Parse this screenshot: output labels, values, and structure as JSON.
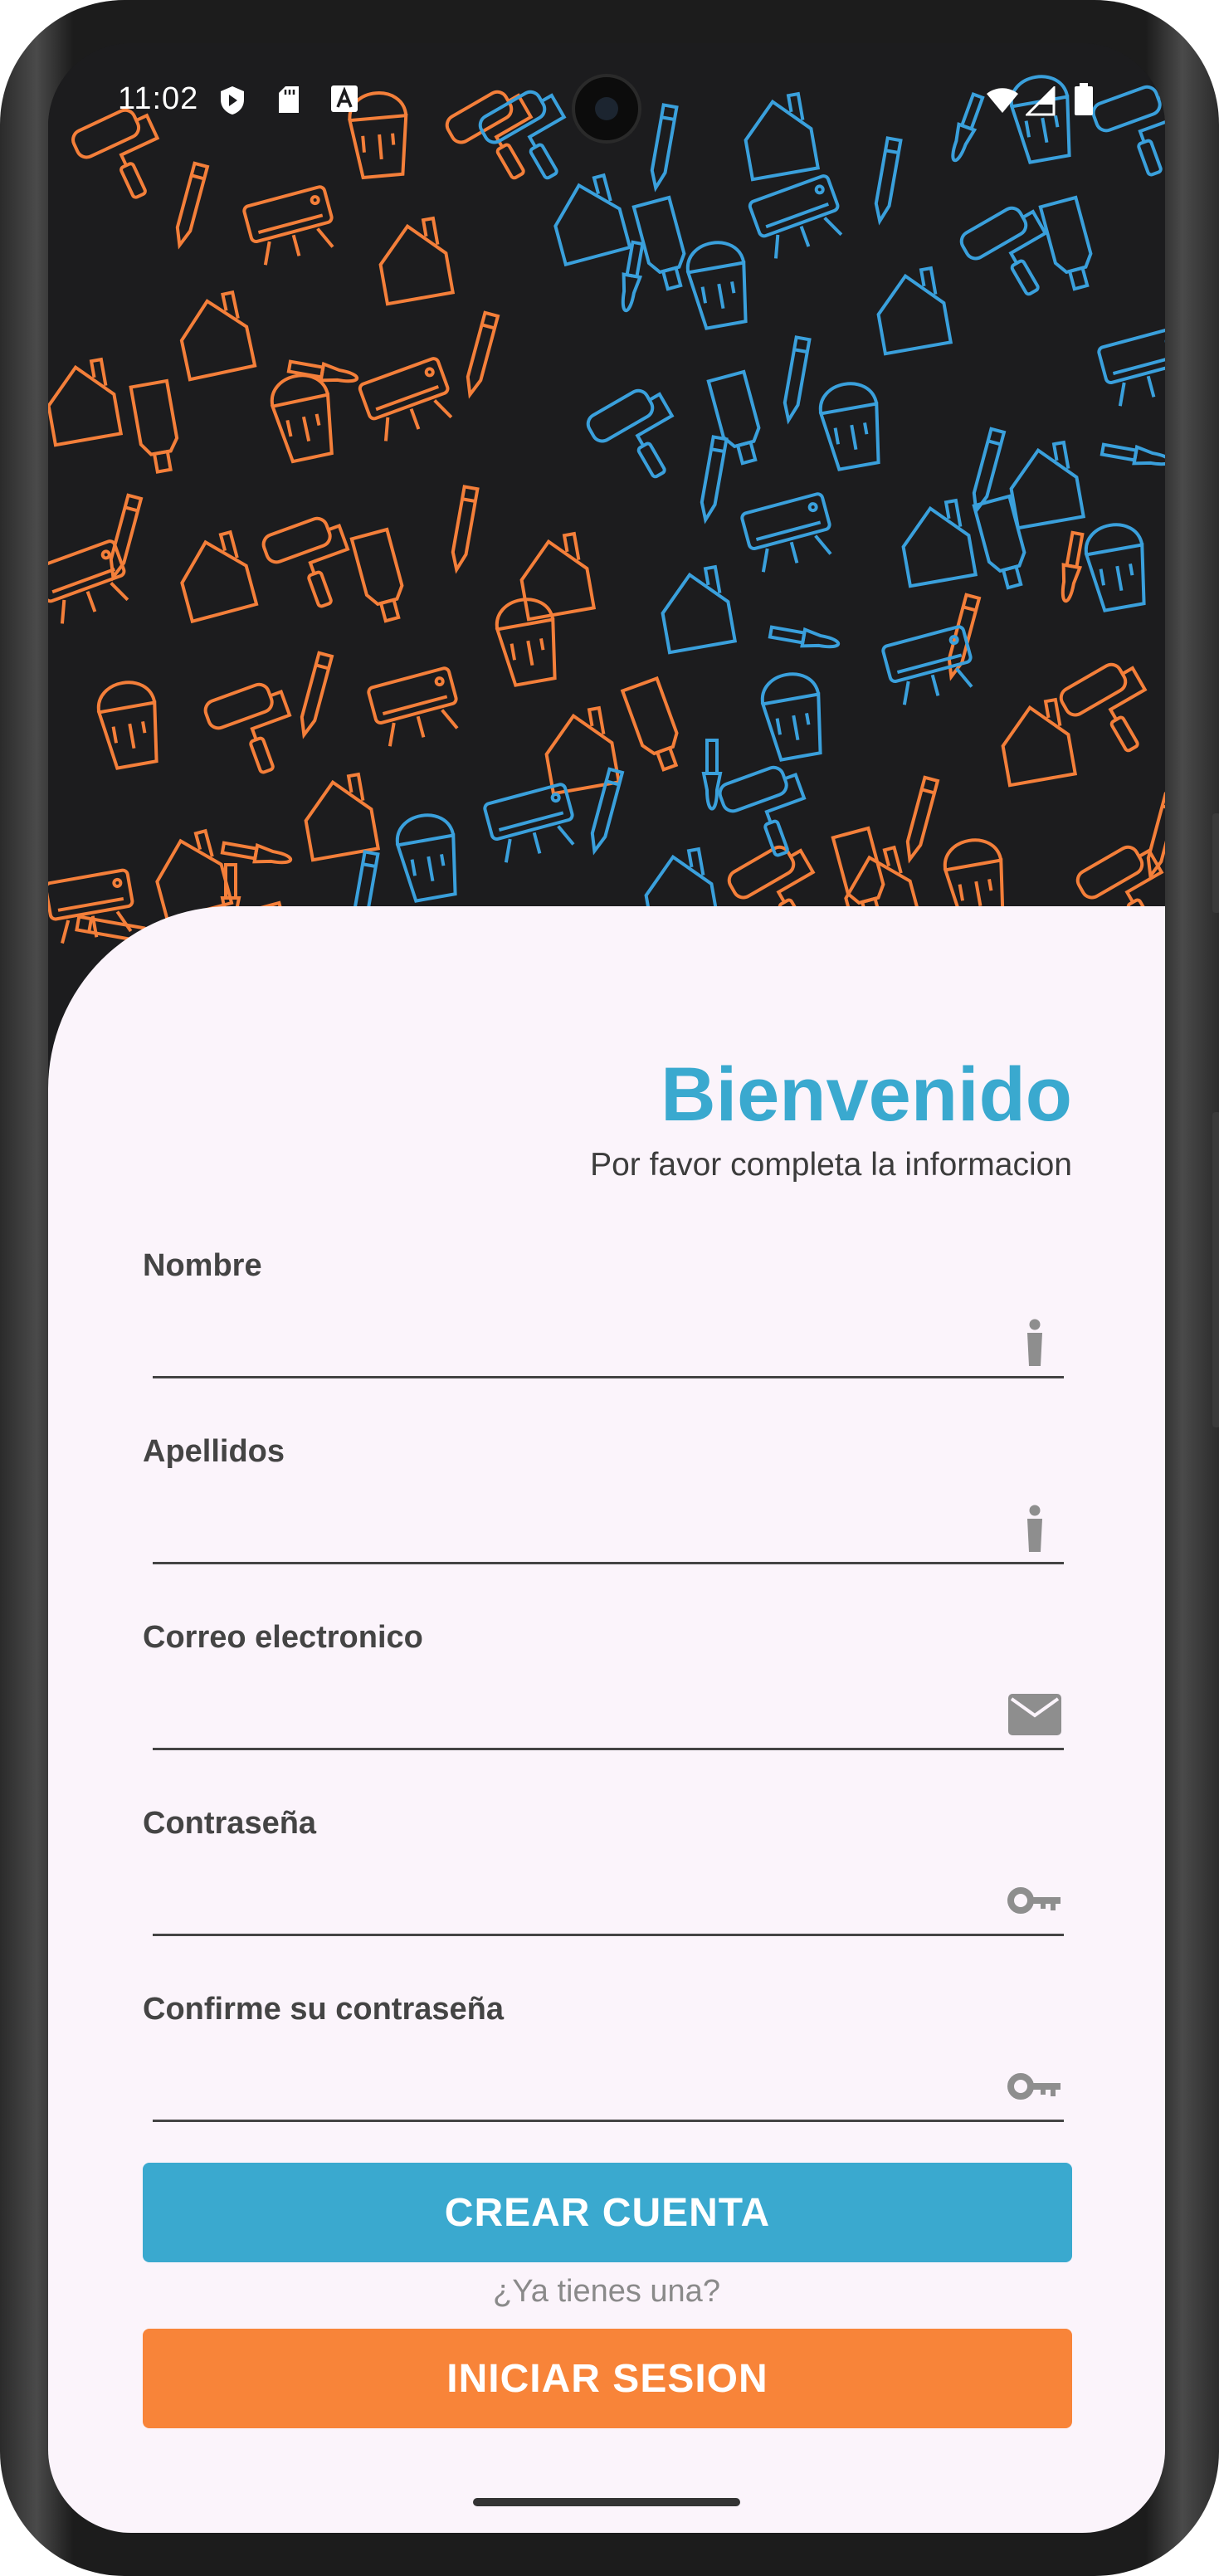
{
  "status_bar": {
    "time": "11:02",
    "left_icons": [
      "shield-play-icon",
      "sd-card-icon",
      "text-a-icon"
    ],
    "right_icons": [
      "wifi-icon",
      "cell-signal-icon",
      "battery-icon"
    ]
  },
  "header": {
    "title": "Bienvenido",
    "subtitle": "Por favor completa la informacion"
  },
  "form": {
    "fields": [
      {
        "label": "Nombre",
        "value": "",
        "icon": "person-icon"
      },
      {
        "label": "Apellidos",
        "value": "",
        "icon": "person-icon"
      },
      {
        "label": "Correo electronico",
        "value": "",
        "icon": "mail-icon"
      },
      {
        "label": "Contraseña",
        "value": "",
        "icon": "key-icon"
      },
      {
        "label": "Confirme su contraseña",
        "value": "",
        "icon": "key-icon"
      }
    ]
  },
  "actions": {
    "create_account": "CREAR CUENTA",
    "have_account": "¿Ya tienes una?",
    "login": "INICIAR SESION"
  },
  "colors": {
    "accent_blue": "#3aa9cf",
    "accent_orange": "#f88439",
    "sheet_background": "#fbf4fb",
    "pattern_background": "#1c1c1e"
  }
}
